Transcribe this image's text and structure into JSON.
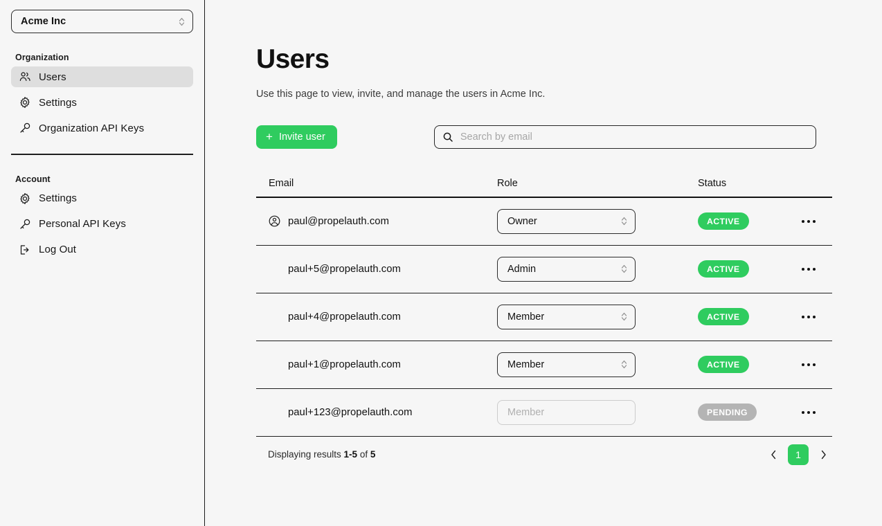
{
  "sidebar": {
    "org_switcher": {
      "label": "Acme Inc",
      "icon": "chevron-up-down-icon"
    },
    "groups": [
      {
        "label": "Organization",
        "items": [
          {
            "label": "Users",
            "icon": "users-icon",
            "active": true
          },
          {
            "label": "Settings",
            "icon": "gear-icon",
            "active": false
          },
          {
            "label": "Organization API Keys",
            "icon": "key-icon",
            "active": false
          }
        ]
      },
      {
        "label": "Account",
        "items": [
          {
            "label": "Settings",
            "icon": "gear-icon",
            "active": false
          },
          {
            "label": "Personal API Keys",
            "icon": "key-icon",
            "active": false
          },
          {
            "label": "Log Out",
            "icon": "logout-icon",
            "active": false
          }
        ]
      }
    ]
  },
  "page": {
    "title": "Users",
    "subtitle": "Use this page to view, invite, and manage the users in Acme Inc."
  },
  "toolbar": {
    "invite_label": "Invite user",
    "invite_icon": "plus-icon",
    "search_placeholder": "Search by email",
    "search_value": "",
    "search_icon": "search-icon"
  },
  "table": {
    "columns": [
      "Email",
      "Role",
      "Status"
    ],
    "rows": [
      {
        "email": "paul@propelauth.com",
        "has_avatar": true,
        "role": "Owner",
        "role_disabled": false,
        "status": "ACTIVE",
        "status_kind": "active"
      },
      {
        "email": "paul+5@propelauth.com",
        "has_avatar": false,
        "role": "Admin",
        "role_disabled": false,
        "status": "ACTIVE",
        "status_kind": "active"
      },
      {
        "email": "paul+4@propelauth.com",
        "has_avatar": false,
        "role": "Member",
        "role_disabled": false,
        "status": "ACTIVE",
        "status_kind": "active"
      },
      {
        "email": "paul+1@propelauth.com",
        "has_avatar": false,
        "role": "Member",
        "role_disabled": false,
        "status": "ACTIVE",
        "status_kind": "active"
      },
      {
        "email": "paul+123@propelauth.com",
        "has_avatar": false,
        "role": "Member",
        "role_disabled": true,
        "status": "PENDING",
        "status_kind": "pending"
      }
    ],
    "row_menu_icon": "ellipsis-icon"
  },
  "footer": {
    "results_prefix": "Displaying results ",
    "results_range": "1-5",
    "results_middle": " of ",
    "results_total": "5",
    "prev_icon": "chevron-left-icon",
    "next_icon": "chevron-right-icon",
    "current_page": "1"
  },
  "colors": {
    "accent_green": "#2fcc5f",
    "pending_gray": "#b4b4b4",
    "page_bg": "#f6f6f6",
    "active_nav_bg": "#dedede"
  }
}
